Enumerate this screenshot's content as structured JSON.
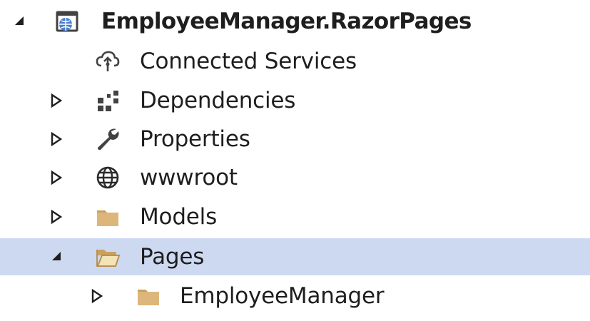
{
  "tree": {
    "project": {
      "label": "EmployeeManager.RazorPages",
      "expanded": true,
      "icon": "web-project-icon"
    },
    "items": [
      {
        "label": "Connected Services",
        "icon": "connected-services-icon",
        "expandable": false
      },
      {
        "label": "Dependencies",
        "icon": "dependencies-icon",
        "expandable": true,
        "expanded": false
      },
      {
        "label": "Properties",
        "icon": "wrench-icon",
        "expandable": true,
        "expanded": false
      },
      {
        "label": "wwwroot",
        "icon": "globe-icon",
        "expandable": true,
        "expanded": false
      },
      {
        "label": "Models",
        "icon": "folder-icon",
        "expandable": true,
        "expanded": false
      },
      {
        "label": "Pages",
        "icon": "folder-open-icon",
        "expandable": true,
        "expanded": true,
        "selected": true
      },
      {
        "label": "EmployeeManager",
        "icon": "folder-icon",
        "expandable": true,
        "expanded": false
      }
    ]
  },
  "colors": {
    "selection": "#cdd9f1",
    "folder": "#dcb67a",
    "text": "#1e1e1e",
    "icon": "#424242"
  }
}
